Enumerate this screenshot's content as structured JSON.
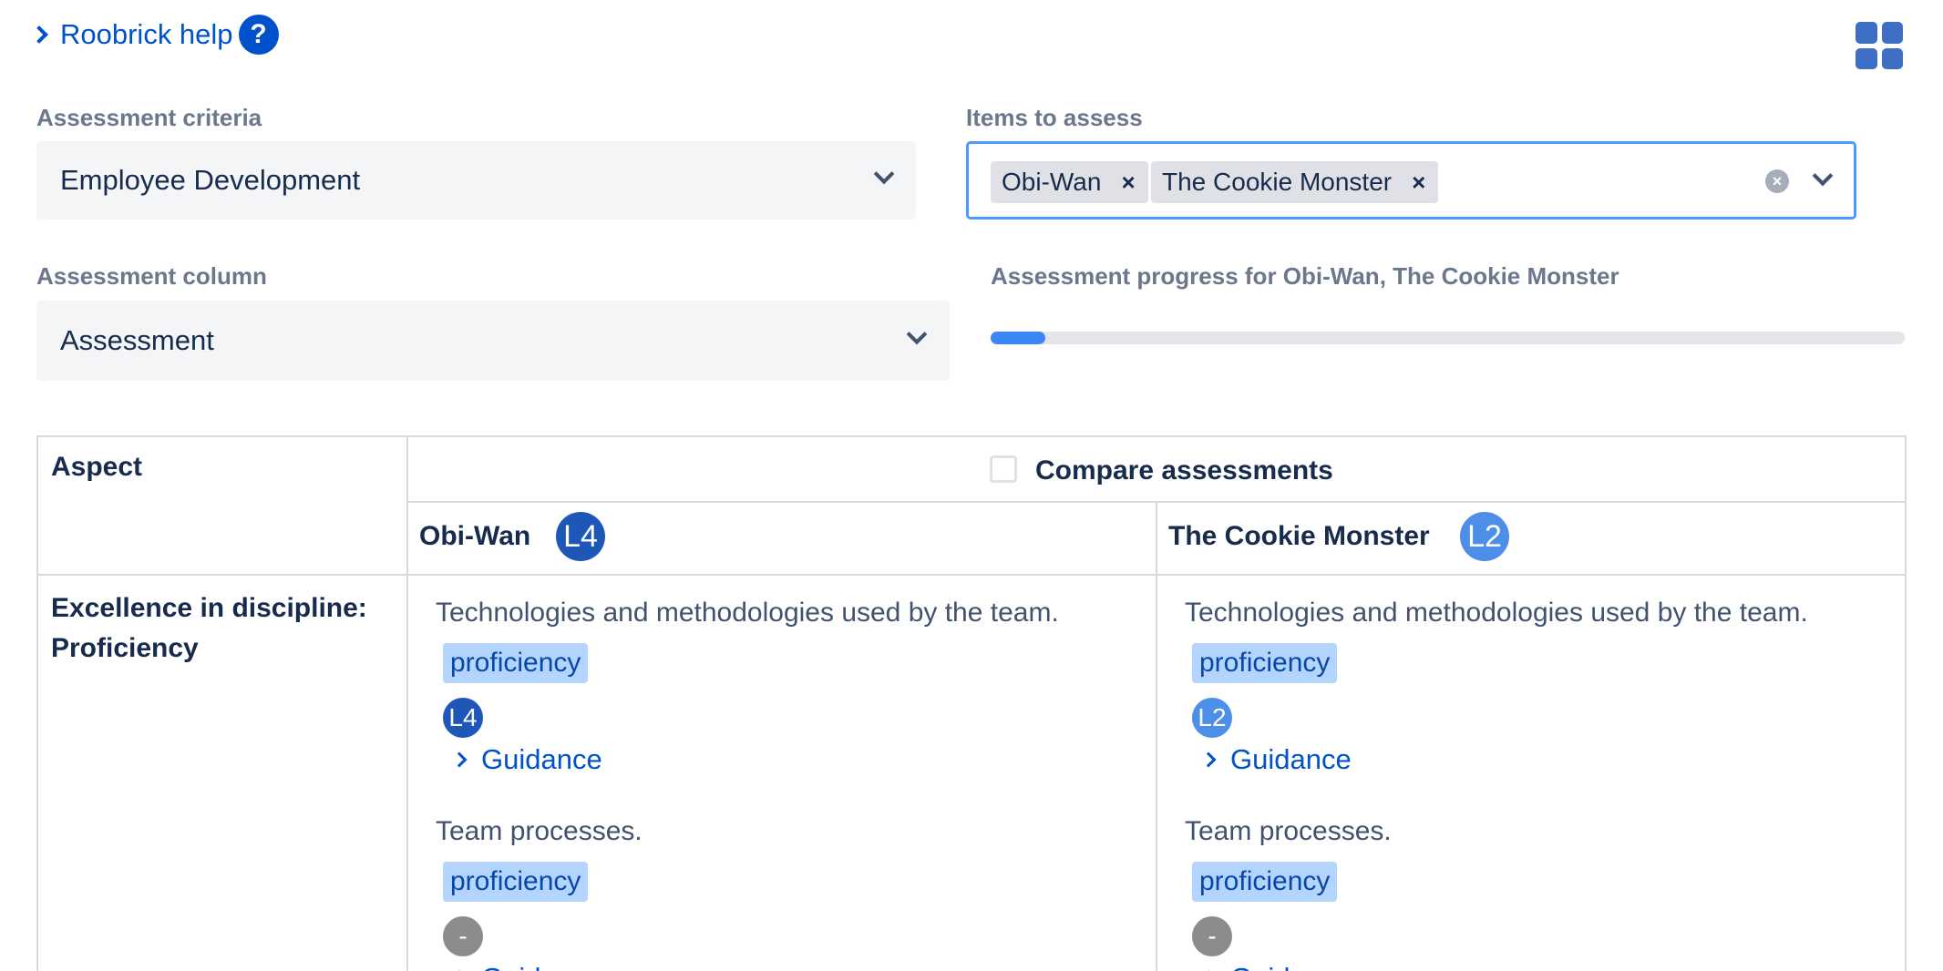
{
  "help": {
    "label": "Roobrick help",
    "icon": "question-circle-icon",
    "q": "?"
  },
  "layout_icon": "grid-layout-icon",
  "criteria": {
    "label": "Assessment criteria",
    "value": "Employee Development"
  },
  "items": {
    "label": "Items to assess",
    "tags": [
      "Obi-Wan",
      "The Cookie Monster"
    ],
    "remove_glyph": "×",
    "clear_glyph": "×"
  },
  "column": {
    "label": "Assessment column",
    "value": "Assessment"
  },
  "progress": {
    "label": "Assessment progress for Obi-Wan, The Cookie Monster",
    "fraction": 0.06
  },
  "table": {
    "aspect_header": "Aspect",
    "compare_label": "Compare assessments",
    "subjects": [
      {
        "name": "Obi-Wan",
        "level": "L4"
      },
      {
        "name": "The Cookie Monster",
        "level": "L2"
      }
    ],
    "row_aspect": "Excellence in discipline: Proficiency",
    "columns": [
      {
        "criteria": [
          {
            "text": "Technologies and methodologies used by the team.",
            "tag": "proficiency",
            "level": "L4",
            "guidance": "Guidance"
          },
          {
            "text": "Team processes.",
            "tag": "proficiency",
            "level": "-",
            "guidance": "Guidance"
          }
        ]
      },
      {
        "criteria": [
          {
            "text": "Technologies and methodologies used by the team.",
            "tag": "proficiency",
            "level": "L2",
            "guidance": "Guidance"
          },
          {
            "text": "Team processes.",
            "tag": "proficiency",
            "level": "-",
            "guidance": "Guidance"
          }
        ]
      }
    ]
  },
  "colors": {
    "accent": "#0052cc",
    "focus_border": "#4c9aff",
    "progress": "#3d86f5",
    "level_l4": "#1f57b8",
    "level_l2": "#4c8ee8",
    "level_none": "#8c8c8c",
    "tag_bg": "#b3d4ff"
  }
}
